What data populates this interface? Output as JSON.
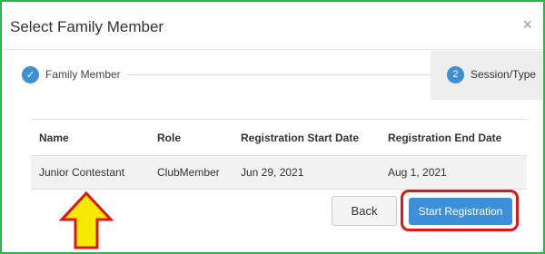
{
  "modal": {
    "title": "Select Family Member",
    "close_glyph": "×"
  },
  "stepper": {
    "steps": [
      {
        "label": "Family Member",
        "marker": "✓",
        "state": "completed"
      },
      {
        "label": "Session/Type",
        "marker": "2",
        "state": "active"
      }
    ]
  },
  "table": {
    "headers": [
      "Name",
      "Role",
      "Registration Start Date",
      "Registration End Date"
    ],
    "rows": [
      [
        "Junior Contestant",
        "ClubMember",
        "Jun 29, 2021",
        "Aug 1, 2021"
      ]
    ]
  },
  "footer": {
    "back_label": "Back",
    "start_label": "Start Registration"
  },
  "annotations": {
    "arrow_color": "#f5ea00",
    "arrow_outline": "#e01515",
    "highlight_color": "#e01515",
    "frame_color": "#2db34a"
  }
}
